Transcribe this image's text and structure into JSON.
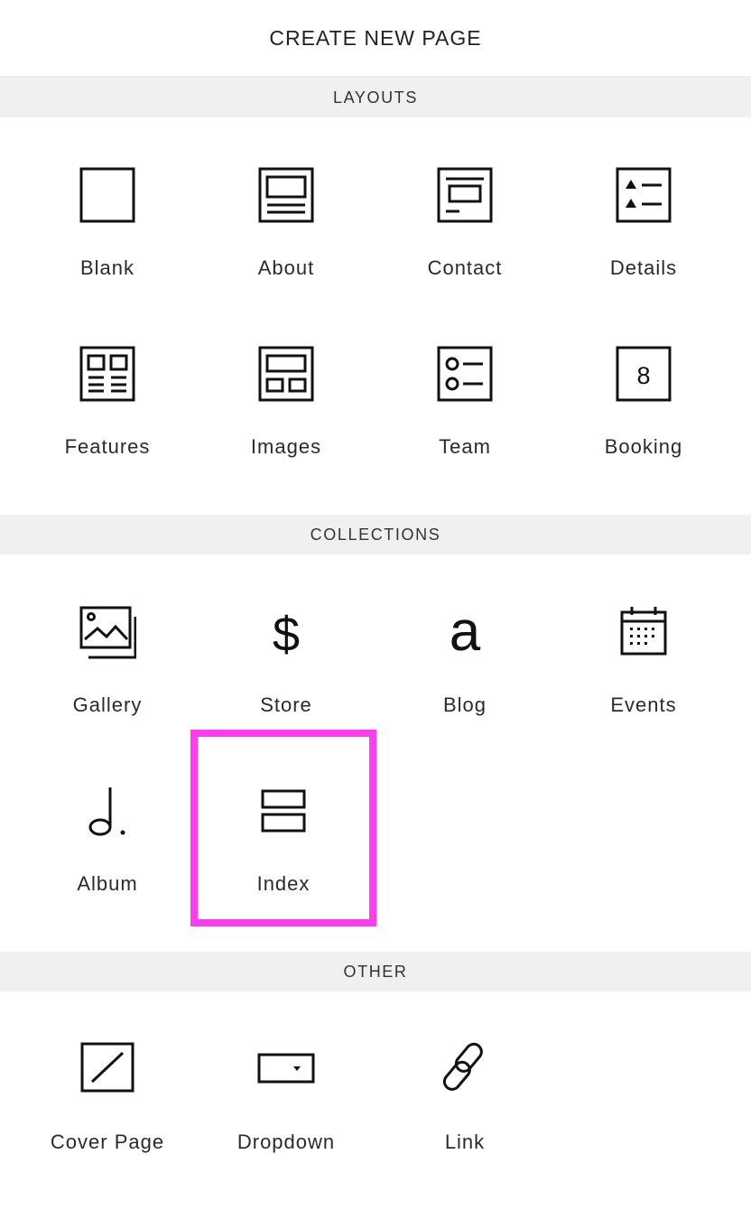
{
  "header": {
    "title": "CREATE NEW PAGE"
  },
  "sections": {
    "layouts": {
      "title": "LAYOUTS",
      "items": [
        {
          "label": "Blank",
          "icon": "blank-page-icon"
        },
        {
          "label": "About",
          "icon": "about-layout-icon"
        },
        {
          "label": "Contact",
          "icon": "contact-layout-icon"
        },
        {
          "label": "Details",
          "icon": "details-layout-icon"
        },
        {
          "label": "Features",
          "icon": "features-layout-icon"
        },
        {
          "label": "Images",
          "icon": "images-layout-icon"
        },
        {
          "label": "Team",
          "icon": "team-layout-icon"
        },
        {
          "label": "Booking",
          "icon": "booking-layout-icon",
          "glyph": "8"
        }
      ]
    },
    "collections": {
      "title": "COLLECTIONS",
      "items": [
        {
          "label": "Gallery",
          "icon": "gallery-icon"
        },
        {
          "label": "Store",
          "icon": "dollar-icon",
          "glyph": "$"
        },
        {
          "label": "Blog",
          "icon": "letter-a-icon",
          "glyph": "a"
        },
        {
          "label": "Events",
          "icon": "calendar-icon"
        },
        {
          "label": "Album",
          "icon": "music-note-icon"
        },
        {
          "label": "Index",
          "icon": "index-stack-icon"
        }
      ]
    },
    "other": {
      "title": "OTHER",
      "items": [
        {
          "label": "Cover Page",
          "icon": "cover-page-icon"
        },
        {
          "label": "Dropdown",
          "icon": "dropdown-icon"
        },
        {
          "label": "Link",
          "icon": "link-chain-icon"
        }
      ]
    }
  },
  "highlight": {
    "color": "#ff3df0",
    "item": "Index"
  }
}
